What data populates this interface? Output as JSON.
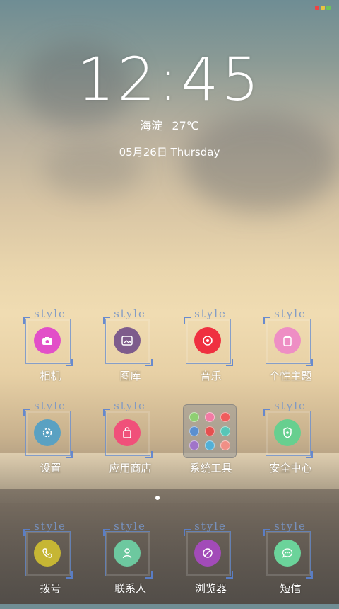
{
  "clock": {
    "time": "12:45"
  },
  "weather": {
    "location": "海淀",
    "temp": "27℃"
  },
  "date": {
    "text": "05月26日 Thursday"
  },
  "style_tag": "style",
  "apps_row1": [
    {
      "label": "相机",
      "color": "#e24fc8",
      "icon": "camera-icon"
    },
    {
      "label": "图库",
      "color": "#7e5c8c",
      "icon": "gallery-icon"
    },
    {
      "label": "音乐",
      "color": "#ef3040",
      "icon": "music-icon"
    },
    {
      "label": "个性主题",
      "color": "#ee8ec4",
      "icon": "theme-icon"
    }
  ],
  "apps_row2": [
    {
      "label": "设置",
      "color": "#5aa1c2",
      "icon": "settings-icon"
    },
    {
      "label": "应用商店",
      "color": "#f0507a",
      "icon": "store-icon"
    },
    {
      "label": "系统工具",
      "color": "#999999",
      "icon": "folder-icon"
    },
    {
      "label": "安全中心",
      "color": "#67cf8f",
      "icon": "security-icon"
    }
  ],
  "apps_dock": [
    {
      "label": "拨号",
      "color": "#c6b634",
      "icon": "phone-icon"
    },
    {
      "label": "联系人",
      "color": "#6dc89f",
      "icon": "contacts-icon"
    },
    {
      "label": "浏览器",
      "color": "#a24bb8",
      "icon": "browser-icon"
    },
    {
      "label": "短信",
      "color": "#6bd39a",
      "icon": "message-icon"
    }
  ],
  "folder_dots": [
    "#8fcf72",
    "#f27aa4",
    "#ef5d5d",
    "#5a8fd0",
    "#e6504f",
    "#57c6b7",
    "#a074c8",
    "#52b0d6",
    "#f08f86"
  ]
}
